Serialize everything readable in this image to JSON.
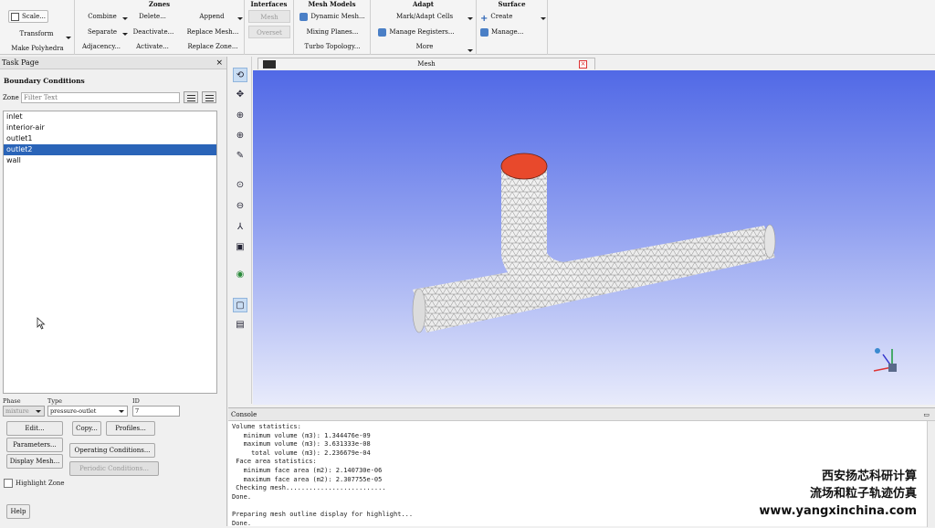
{
  "ribbon": {
    "groups": {
      "zones": "Zones",
      "interfaces": "Interfaces",
      "mesh_models": "Mesh Models",
      "adapt": "Adapt",
      "surface": "Surface"
    },
    "mesh": {
      "scale": "Scale...",
      "transform": "Transform",
      "make_polyhedra": "Make Polyhedra"
    },
    "zones": {
      "combine": "Combine",
      "separate": "Separate",
      "adjacency": "Adjacency...",
      "delete": "Delete...",
      "deactivate": "Deactivate...",
      "activate": "Activate...",
      "append": "Append",
      "replace_mesh": "Replace Mesh...",
      "replace_zone": "Replace Zone..."
    },
    "interfaces": {
      "mesh": "Mesh",
      "overset": "Overset"
    },
    "mesh_models": {
      "dynamic_mesh": "Dynamic Mesh...",
      "mixing_planes": "Mixing Planes...",
      "turbo_topology": "Turbo Topology..."
    },
    "adapt": {
      "mark_adapt": "Mark/Adapt Cells",
      "manage_registers": "Manage Registers...",
      "more": "More"
    },
    "surface": {
      "create": "Create",
      "manage": "Manage..."
    }
  },
  "task_page": {
    "header": "Task Page",
    "close_glyph": "×",
    "title": "Boundary Conditions",
    "zone_label": "Zone",
    "filter_placeholder": "Filter Text",
    "zones": [
      {
        "name": "inlet",
        "selected": false
      },
      {
        "name": "interior-air",
        "selected": false
      },
      {
        "name": "outlet1",
        "selected": false
      },
      {
        "name": "outlet2",
        "selected": true
      },
      {
        "name": "wall",
        "selected": false
      }
    ],
    "phase_label": "Phase",
    "phase_value": "mixture",
    "type_label": "Type",
    "type_value": "pressure-outlet",
    "id_label": "ID",
    "id_value": "7",
    "buttons": {
      "edit": "Edit...",
      "copy": "Copy...",
      "profiles": "Profiles...",
      "parameters": "Parameters...",
      "operating_conditions": "Operating Conditions...",
      "display_mesh": "Display Mesh...",
      "periodic_conditions": "Periodic Conditions...",
      "help": "Help"
    },
    "highlight_zone": "Highlight Zone"
  },
  "graphics": {
    "tab_title": "Mesh",
    "close_glyph": "×",
    "mesh_fill": "#f2f2f2",
    "inlet_color": "#e8492c",
    "background_top": "#5169e6",
    "background_bottom": "#e8ebfb"
  },
  "console": {
    "title": "Console",
    "lines": [
      "Volume statistics:",
      "   minimum volume (m3): 1.344476e-09",
      "   maximum volume (m3): 3.631333e-08",
      "     total volume (m3): 2.236679e-04",
      " Face area statistics:",
      "   minimum face area (m2): 2.140730e-06",
      "   maximum face area (m2): 2.307755e-05",
      " Checking mesh..........................",
      "Done.",
      "",
      "Preparing mesh outline display for highlight...",
      "Done."
    ]
  },
  "watermark": {
    "line1": "西安扬芯科研计算",
    "line2": "流场和粒子轨迹仿真",
    "line3": "www.yangxinchina.com"
  }
}
